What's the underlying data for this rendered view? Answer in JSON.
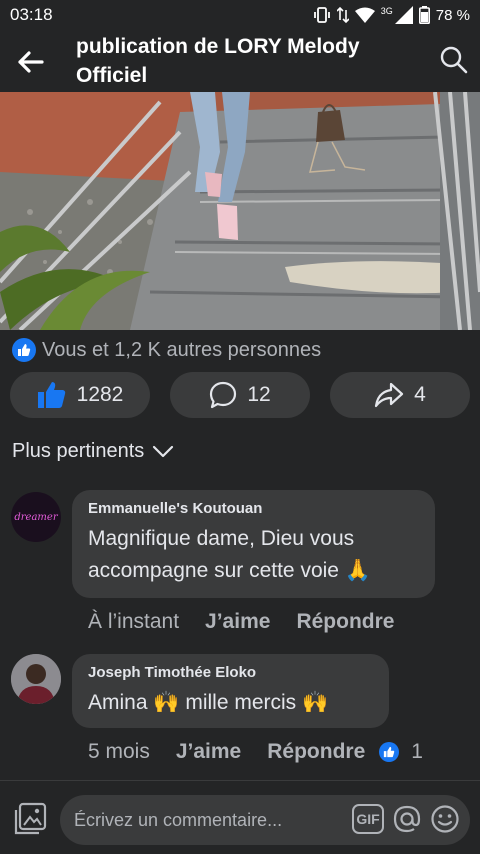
{
  "status_bar": {
    "time": "03:18",
    "network": "3G",
    "battery": "78 %"
  },
  "header": {
    "title_line1": "publication de LORY Melody",
    "title_line2": "Officiel"
  },
  "reactions_summary": "Vous et 1,2 K autres personnes",
  "actions": {
    "likes": "1282",
    "comments": "12",
    "shares": "4"
  },
  "sort_label": "Plus pertinents",
  "comments": [
    {
      "author": "Emmanuelle's Koutouan",
      "text_line1": "Magnifique dame, Dieu vous",
      "text_line2": "accompagne sur cette voie 🙏",
      "avatar_text": "dreamer",
      "time": "À l’instant",
      "like_label": "J’aime",
      "reply_label": "Répondre"
    },
    {
      "author": "Joseph Timothée Eloko",
      "text": "Amina 🙌 mille mercis 🙌",
      "time": "5 mois",
      "like_label": "J’aime",
      "reply_label": "Répondre",
      "reaction_count": "1"
    }
  ],
  "composer": {
    "placeholder": "Écrivez un commentaire...",
    "gif_label": "GIF"
  },
  "colors": {
    "background": "#242526",
    "surface": "#3a3b3c",
    "accent": "#1877f2",
    "text": "#e4e6eb",
    "muted": "#b0b3b8"
  }
}
